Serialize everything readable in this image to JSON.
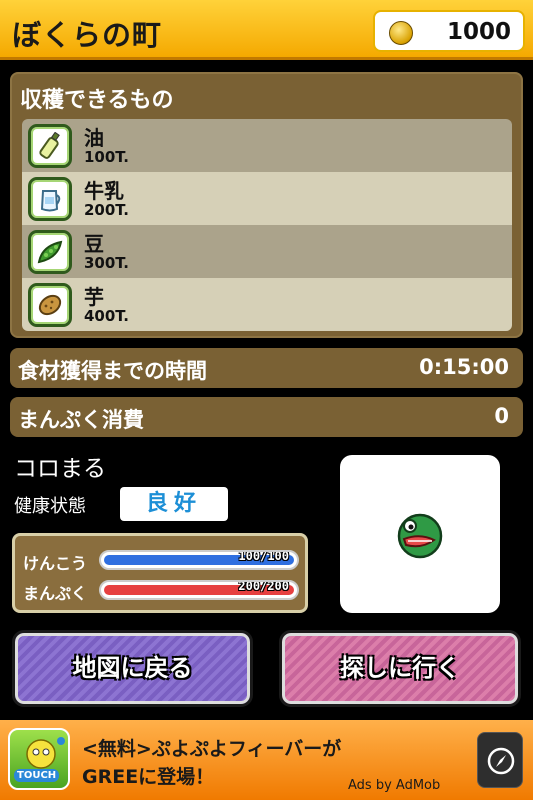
{
  "header": {
    "title": "ぼくらの町",
    "coins": "1000"
  },
  "harvest": {
    "title": "収穫できるもの",
    "items": [
      {
        "name": "油",
        "time": "100T.",
        "icon": "oil-bottle-icon"
      },
      {
        "name": "牛乳",
        "time": "200T.",
        "icon": "milk-jug-icon"
      },
      {
        "name": "豆",
        "time": "300T.",
        "icon": "bean-pod-icon"
      },
      {
        "name": "芋",
        "time": "400T.",
        "icon": "potato-icon"
      }
    ]
  },
  "timer": {
    "label": "食材獲得までの時間",
    "value": "0:15:00"
  },
  "fullness_consume": {
    "label": "まんぷく消費",
    "value": "0"
  },
  "pet": {
    "name": "コロまる",
    "health_label": "健康状態",
    "health_status": "良好",
    "stats": [
      {
        "label": "けんこう",
        "value": "100/100",
        "fraction": 1.0,
        "color": "#2f6fe0"
      },
      {
        "label": "まんぷく",
        "value": "200/200",
        "fraction": 1.0,
        "color": "#e64040"
      }
    ]
  },
  "buttons": {
    "map": "地図に戻る",
    "search": "探しに行く"
  },
  "ad": {
    "line1": "<無料>ぷよぷよフィーバーが",
    "line2": "GREEに登場！",
    "by": "Ads by AdMob",
    "logo_text": "TOUCH"
  }
}
